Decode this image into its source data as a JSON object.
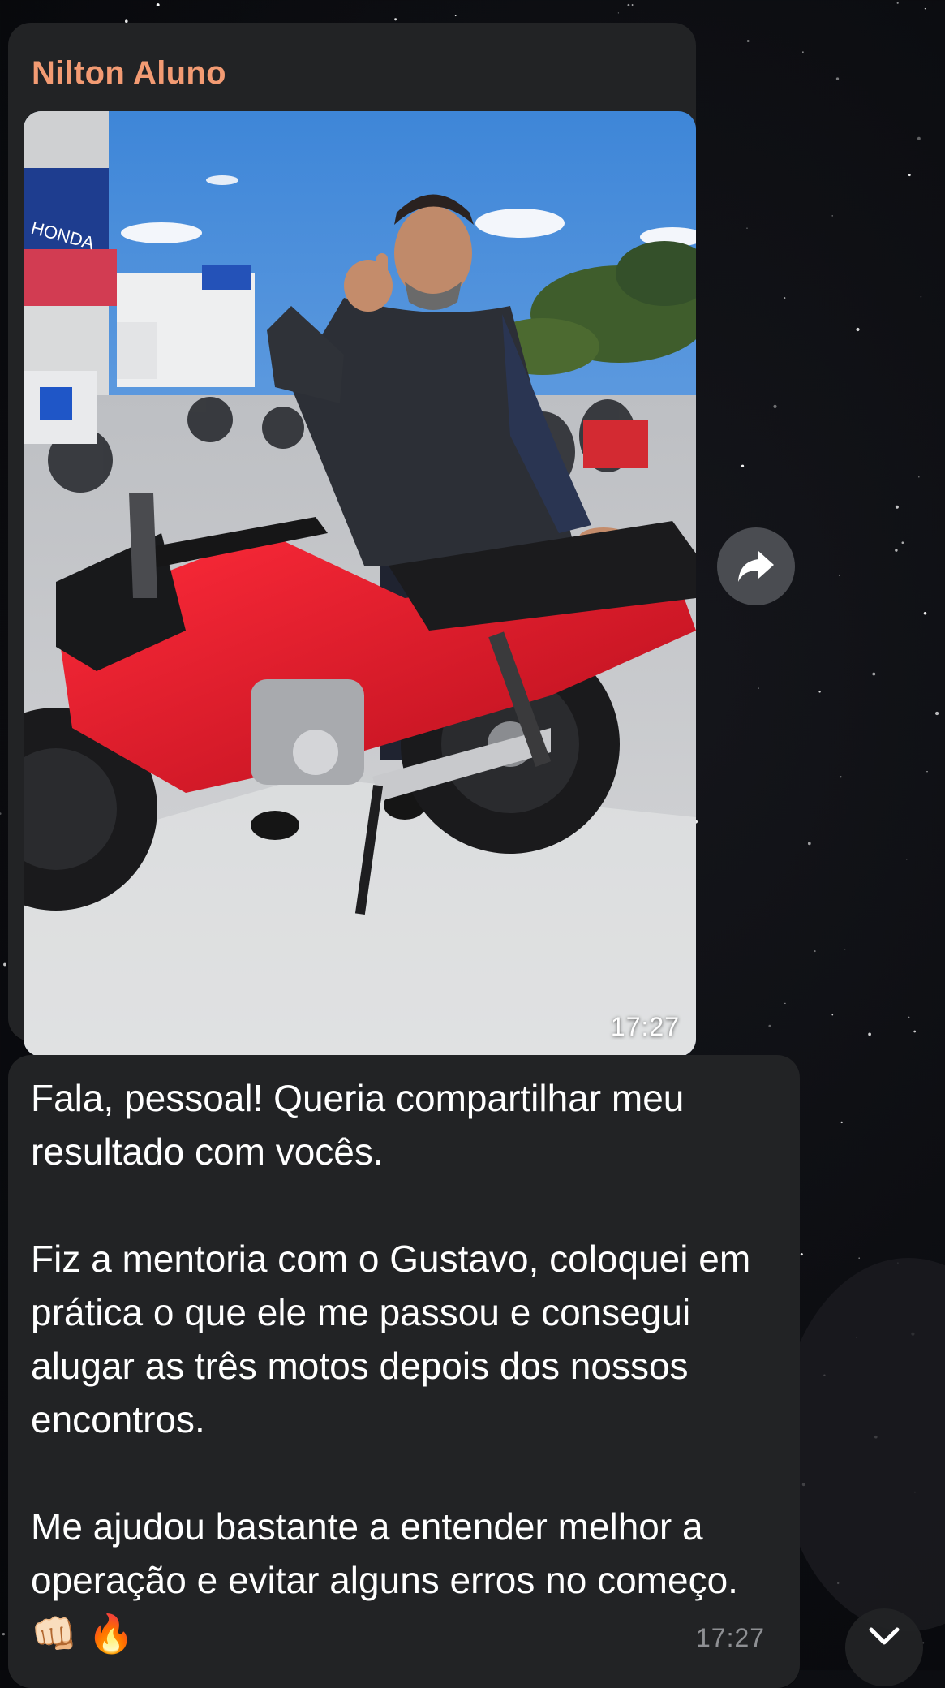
{
  "message_photo": {
    "sender_name": "Nilton Aluno",
    "time": "17:27",
    "image_subject": "man-with-red-motorcycle",
    "photo_alt": "Homem fazendo sinal de positivo ao lado de uma moto vermelha em uma concessionária"
  },
  "message_text": {
    "text": "Fala, pessoal! Queria compartilhar meu resultado com vocês.\n\nFiz a mentoria com o Gustavo, coloquei em prática o que ele me passou e consegui alugar as três motos depois dos nossos encontros.\n\nMe ajudou bastante a entender melhor a operação e evitar alguns erros no começo. 👊🏻 🔥",
    "time": "17:27"
  },
  "icons": {
    "forward": "forward-arrow-icon",
    "scroll_down": "chevron-down-icon"
  },
  "colors": {
    "sender_name": "#f39b73",
    "bubble": "#222325",
    "background": "#0b0c10"
  }
}
